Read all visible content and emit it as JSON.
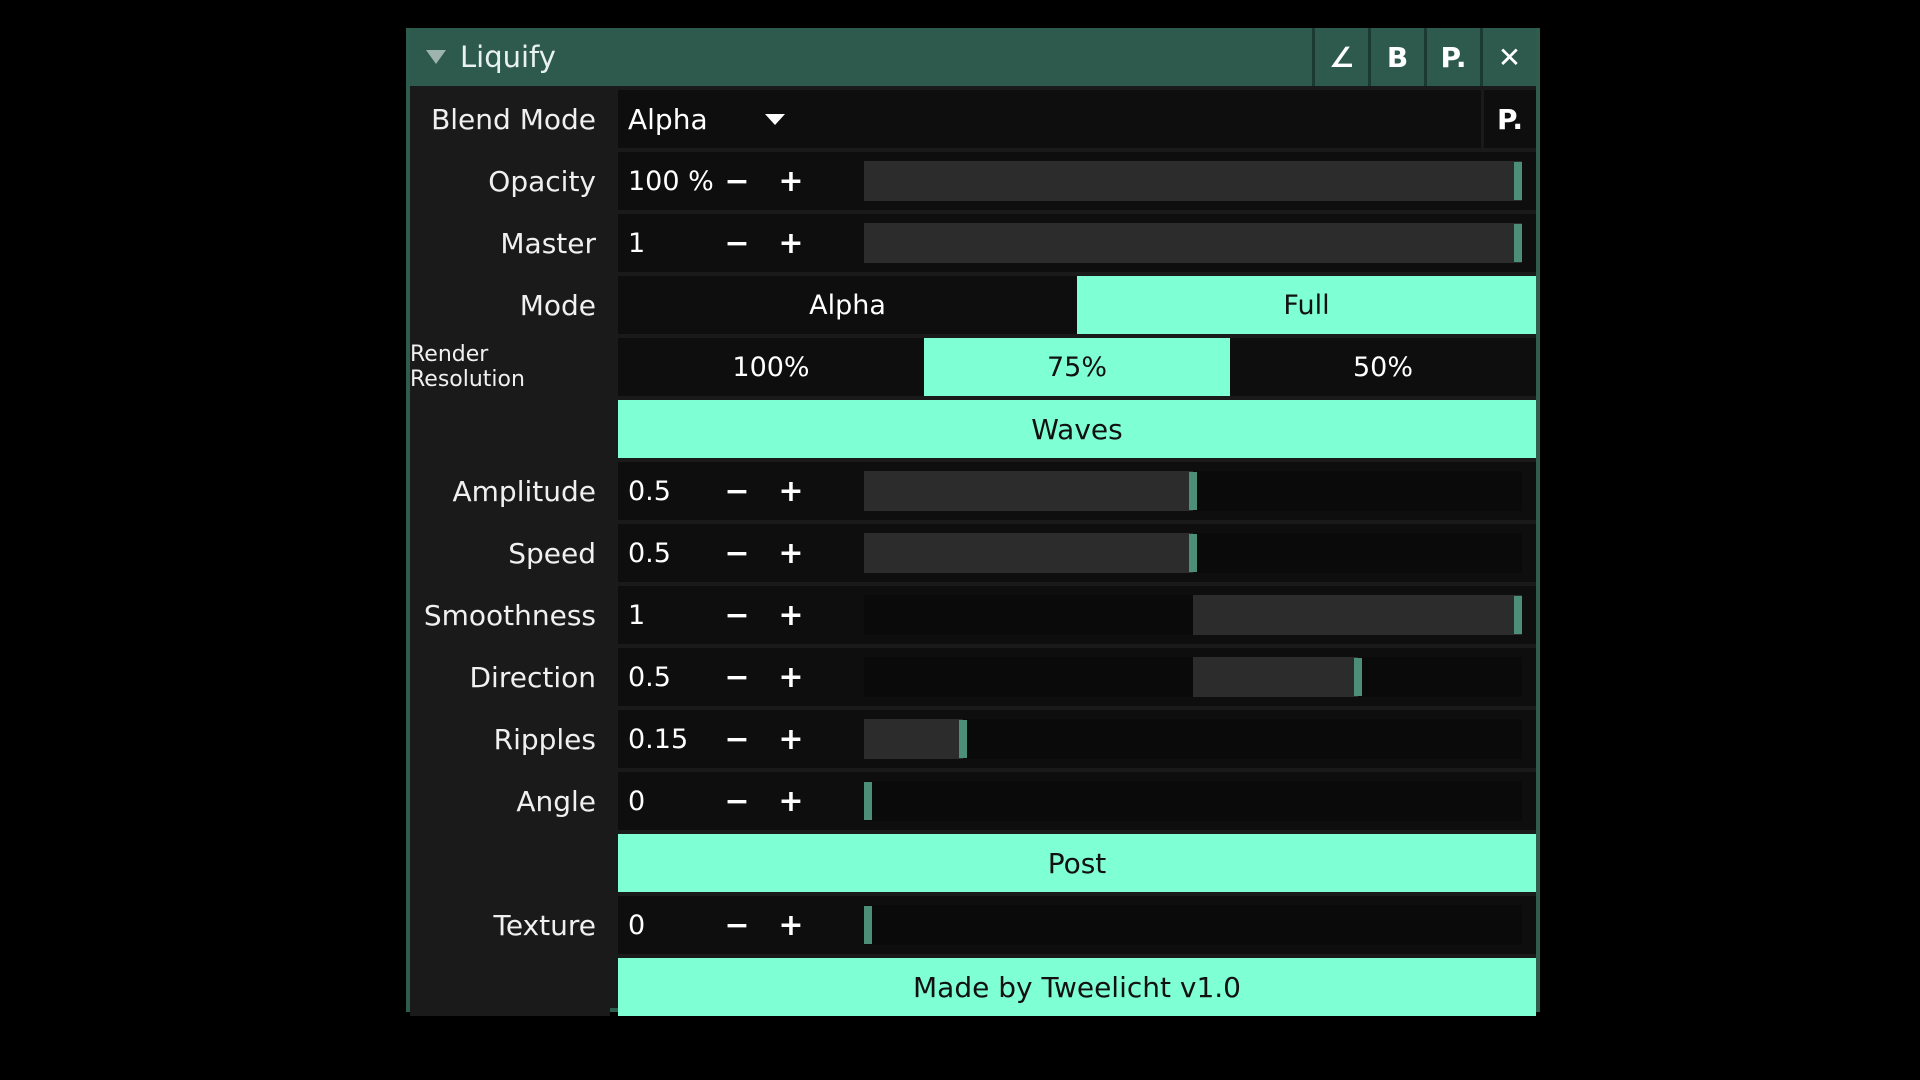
{
  "window": {
    "title": "Liquify",
    "buttons": [
      "∠",
      "B",
      "P.",
      "✕"
    ]
  },
  "blend_mode": {
    "label": "Blend Mode",
    "value": "Alpha",
    "preset_button": "P."
  },
  "sliders_top": [
    {
      "label": "Opacity",
      "value": "100 %",
      "fraction": 1.0,
      "fill_from": 0
    },
    {
      "label": "Master",
      "value": "1",
      "fraction": 1.0,
      "fill_from": 0
    }
  ],
  "mode": {
    "label": "Mode",
    "options": [
      "Alpha",
      "Full"
    ],
    "selected": 1
  },
  "render_resolution": {
    "label": "Render Resolution",
    "options": [
      "100%",
      "75%",
      "50%"
    ],
    "selected": 1
  },
  "waves_header": "Waves",
  "waves_sliders": [
    {
      "label": "Amplitude",
      "value": "0.5",
      "fraction": 0.5,
      "fill_from": 0
    },
    {
      "label": "Speed",
      "value": "0.5",
      "fraction": 0.5,
      "fill_from": 0
    },
    {
      "label": "Smoothness",
      "value": "1",
      "fraction": 1.0,
      "fill_from": 0.5
    },
    {
      "label": "Direction",
      "value": "0.5",
      "fraction": 0.75,
      "fill_from": 0.5
    },
    {
      "label": "Ripples",
      "value": "0.15",
      "fraction": 0.15,
      "fill_from": 0
    },
    {
      "label": "Angle",
      "value": "0",
      "fraction": 0.0,
      "fill_from": 0
    }
  ],
  "post_header": "Post",
  "post_sliders": [
    {
      "label": "Texture",
      "value": "0",
      "fraction": 0.0,
      "fill_from": 0
    }
  ],
  "footer": "Made by Tweelicht v1.0",
  "symbols": {
    "minus": "−",
    "plus": "+"
  },
  "colors": {
    "accent": "#7fffd4",
    "title_bar": "#2e5a4e",
    "handle": "#4d8e78"
  }
}
